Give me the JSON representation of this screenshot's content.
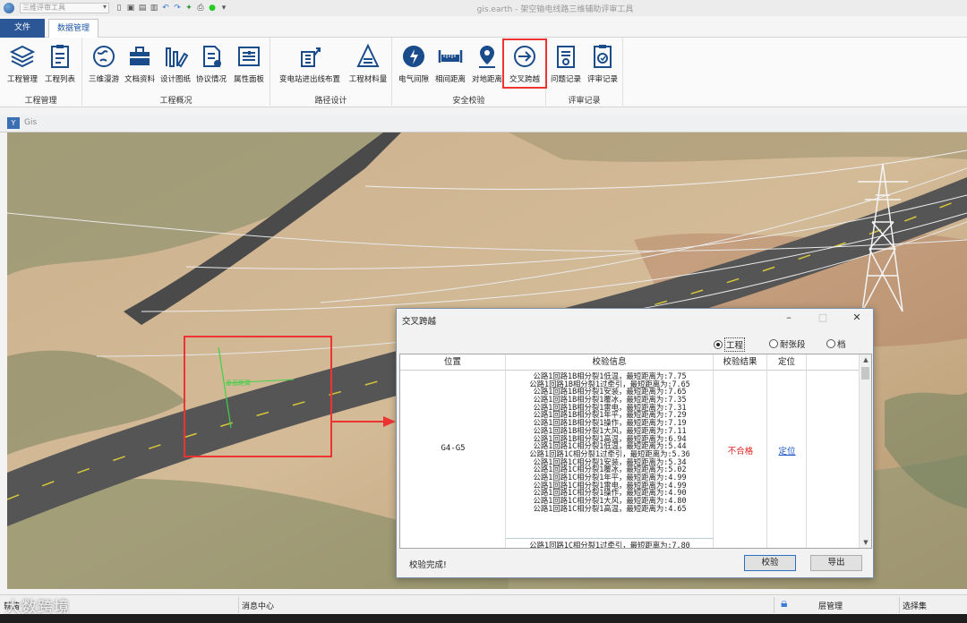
{
  "titlebar": {
    "quick_select": "三维评审工具",
    "window_title": "gis.earth - 架空输电线路三维辅助评审工具"
  },
  "tabs": {
    "file": "文件",
    "data_manage": "数据管理"
  },
  "ribbon": {
    "groups": [
      {
        "label": "工程管理",
        "buttons": [
          {
            "label": "工程管理",
            "icon": "layers-icon"
          },
          {
            "label": "工程列表",
            "icon": "list-doc-icon"
          }
        ]
      },
      {
        "label": "工程概况",
        "buttons": [
          {
            "label": "三维漫游",
            "icon": "globe-icon"
          },
          {
            "label": "文档资料",
            "icon": "briefcase-icon"
          },
          {
            "label": "设计图纸",
            "icon": "drawing-icon"
          },
          {
            "label": "协议情况",
            "icon": "agreement-icon"
          },
          {
            "label": "属性面板",
            "icon": "property-panel-icon"
          }
        ]
      },
      {
        "label": "路径设计",
        "buttons": [
          {
            "label": "变电站进出线布置",
            "icon": "substation-icon"
          },
          {
            "label": "工程材料量",
            "icon": "material-icon"
          }
        ]
      },
      {
        "label": "安全校验",
        "buttons": [
          {
            "label": "电气间隙",
            "icon": "electric-clearance-icon"
          },
          {
            "label": "相间距离",
            "icon": "ruler-icon"
          },
          {
            "label": "对地距离",
            "icon": "pin-icon"
          },
          {
            "label": "交叉跨越",
            "icon": "crossing-icon"
          }
        ]
      },
      {
        "label": "评审记录",
        "buttons": [
          {
            "label": "问题记录",
            "icon": "issue-record-icon"
          },
          {
            "label": "评审记录",
            "icon": "review-record-icon"
          }
        ]
      }
    ]
  },
  "gis": {
    "pane_title": "Gis",
    "map_label": "垂直距离"
  },
  "dialog": {
    "title": "交叉跨越",
    "radios": [
      {
        "label": "工程",
        "checked": true
      },
      {
        "label": "耐张段",
        "checked": false
      },
      {
        "label": "档",
        "checked": false
      }
    ],
    "columns": [
      "位置",
      "校验信息",
      "校验结果",
      "定位"
    ],
    "row": {
      "position": "G4-G5",
      "result": "不合格",
      "locate": "定位",
      "info": [
        "公路1回路1B相分裂1低温，最短距离为:7.75",
        "公路1回路1B相分裂1过牵引，最短距离为:7.65",
        "公路1回路1B相分裂1安装，最短距离为:7.65",
        "公路1回路1B相分裂1覆冰，最短距离为:7.35",
        "公路1回路1B相分裂1雷电，最短距离为:7.31",
        "公路1回路1B相分裂1年平，最短距离为:7.29",
        "公路1回路1B相分裂1操作，最短距离为:7.19",
        "公路1回路1B相分裂1大风，最短距离为:7.11",
        "公路1回路1B相分裂1高温，最短距离为:6.94",
        "公路1回路1C相分裂1低温，最短距离为:5.44",
        "公路1回路1C相分裂1过牵引，最短距离为:5.36",
        "公路1回路1C相分裂1安装，最短距离为:5.34",
        "公路1回路1C相分裂1覆冰，最短距离为:5.02",
        "公路1回路1C相分裂1年平，最短距离为:4.99",
        "公路1回路1C相分裂1雷电，最短距离为:4.99",
        "公路1回路1C相分裂1操作，最短距离为:4.90",
        "公路1回路1C相分裂1大风，最短距离为:4.80",
        "公路1回路1C相分裂1高温，最短距离为:4.65"
      ],
      "next_line": "公路1回路1C相分裂1过牵引，最短距离为:7.80"
    },
    "status": "校验完成!",
    "btn_check": "校验",
    "btn_export": "导出"
  },
  "statusbar": {
    "ready": "就绪",
    "message_center": "消息中心",
    "layer_manage": "层管理",
    "selection_set": "选择集"
  },
  "watermark": "大数跨境"
}
